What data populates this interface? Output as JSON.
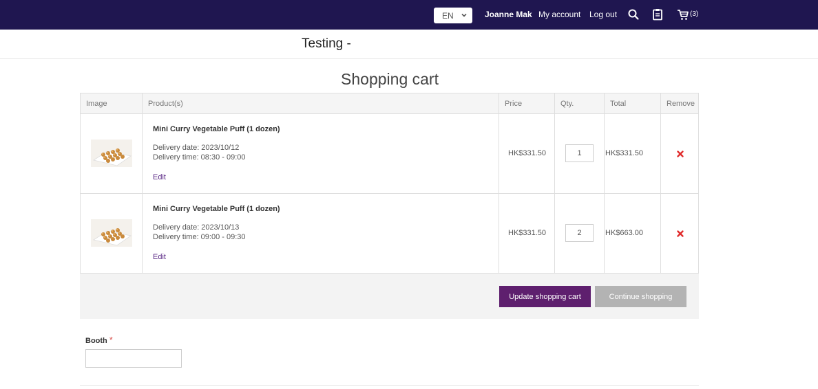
{
  "topbar": {
    "language": "EN",
    "user_name": "Joanne Mak",
    "my_account": "My account",
    "log_out": "Log out",
    "cart_count": "(3)",
    "icons": [
      "chevron-down-icon",
      "search-icon",
      "clipboard-icon",
      "cart-icon"
    ],
    "background": "#1f1650"
  },
  "store": {
    "title": "Testing -"
  },
  "page": {
    "title": "Shopping cart"
  },
  "cart": {
    "headers": {
      "image": "Image",
      "products": "Product(s)",
      "price": "Price",
      "qty": "Qty.",
      "total": "Total",
      "remove": "Remove"
    },
    "items": [
      {
        "name": "Mini Curry Vegetable Puff (1 dozen)",
        "delivery_date": "Delivery date: 2023/10/12",
        "delivery_time": "Delivery time: 08:30 - 09:00",
        "edit": "Edit",
        "price": "HK$331.50",
        "qty": "1",
        "total": "HK$331.50"
      },
      {
        "name": "Mini Curry Vegetable Puff (1 dozen)",
        "delivery_date": "Delivery date: 2023/10/13",
        "delivery_time": "Delivery time: 09:00 - 09:30",
        "edit": "Edit",
        "price": "HK$331.50",
        "qty": "2",
        "total": "HK$663.00"
      }
    ],
    "update_button": "Update shopping cart",
    "continue_button": "Continue shopping",
    "accent_color": "#5e1f6e",
    "remove_color": "#e02b2b"
  },
  "booth": {
    "label": "Booth",
    "required_mark": "*",
    "value": ""
  }
}
